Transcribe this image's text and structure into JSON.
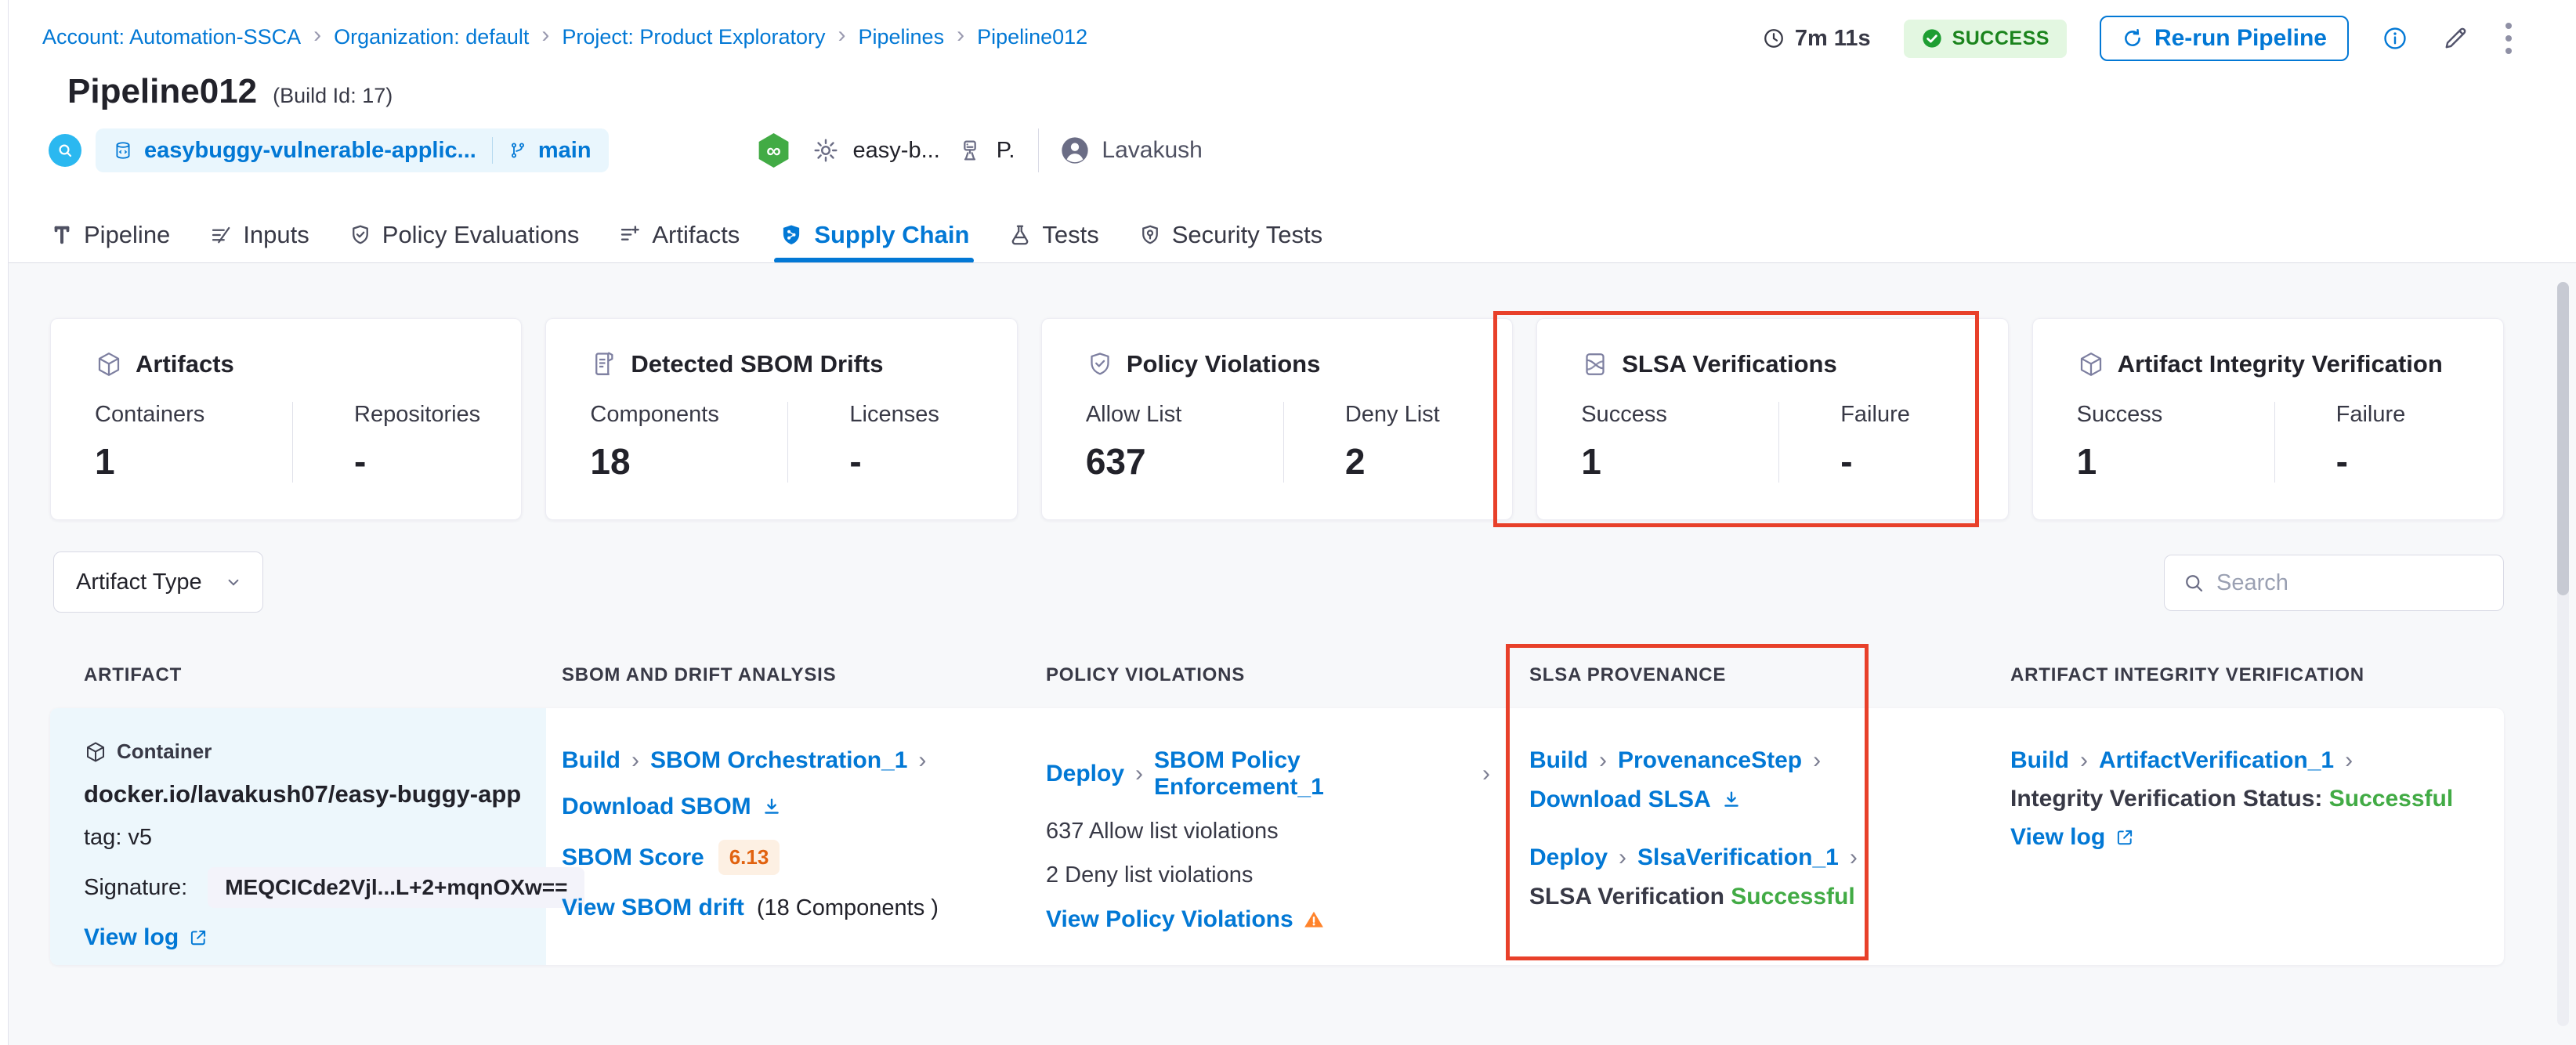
{
  "breadcrumb": {
    "items": [
      "Account: Automation-SSCA",
      "Organization: default",
      "Project: Product Exploratory",
      "Pipelines",
      "Pipeline012"
    ]
  },
  "header": {
    "duration": "7m 11s",
    "status": "SUCCESS",
    "rerun_label": "Re-run Pipeline",
    "title": "Pipeline012",
    "build_id": "(Build Id: 17)",
    "repo": "easybuggy-vulnerable-applic...",
    "branch": "main",
    "trigger_name": "easy-b...",
    "trigger_abbrev": "P.",
    "user": "Lavakush"
  },
  "tabs": [
    {
      "label": "Pipeline"
    },
    {
      "label": "Inputs"
    },
    {
      "label": "Policy Evaluations"
    },
    {
      "label": "Artifacts"
    },
    {
      "label": "Supply Chain",
      "active": true
    },
    {
      "label": "Tests"
    },
    {
      "label": "Security Tests"
    }
  ],
  "cards": [
    {
      "title": "Artifacts",
      "stats": [
        {
          "label": "Containers",
          "value": "1"
        },
        {
          "label": "Repositories",
          "value": "-"
        }
      ]
    },
    {
      "title": "Detected SBOM Drifts",
      "stats": [
        {
          "label": "Components",
          "value": "18"
        },
        {
          "label": "Licenses",
          "value": "-"
        }
      ]
    },
    {
      "title": "Policy Violations",
      "stats": [
        {
          "label": "Allow List",
          "value": "637"
        },
        {
          "label": "Deny List",
          "value": "2"
        }
      ]
    },
    {
      "title": "SLSA Verifications",
      "stats": [
        {
          "label": "Success",
          "value": "1"
        },
        {
          "label": "Failure",
          "value": "-"
        }
      ],
      "highlighted": true
    },
    {
      "title": "Artifact Integrity Verification",
      "stats": [
        {
          "label": "Success",
          "value": "1"
        },
        {
          "label": "Failure",
          "value": "-"
        }
      ]
    }
  ],
  "filters": {
    "artifact_type_label": "Artifact Type",
    "search_placeholder": "Search"
  },
  "table": {
    "columns": [
      "ARTIFACT",
      "SBOM AND DRIFT ANALYSIS",
      "POLICY VIOLATIONS",
      "SLSA PROVENANCE",
      "ARTIFACT INTEGRITY VERIFICATION"
    ],
    "row": {
      "artifact": {
        "type_label": "Container",
        "image": "docker.io/lavakush07/easy-buggy-app",
        "tag": "tag: v5",
        "signature_label": "Signature:",
        "signature": "MEQCICde2Vjl...L+2+mqnOXw==",
        "view_log": "View log"
      },
      "sbom": {
        "stage": "Build",
        "step": "SBOM Orchestration_1",
        "download_label": "Download SBOM",
        "score_label": "SBOM Score",
        "score": "6.13",
        "drift_link": "View SBOM drift",
        "drift_detail": "(18 Components )"
      },
      "policy": {
        "stage": "Deploy",
        "step": "SBOM Policy Enforcement_1",
        "allow": "637 Allow list violations",
        "deny": "2 Deny list violations",
        "view_link": "View Policy Violations"
      },
      "slsa": {
        "stage1": "Build",
        "step1": "ProvenanceStep",
        "download_label": "Download SLSA",
        "stage2": "Deploy",
        "step2": "SlsaVerification_1",
        "status_label": "SLSA Verification",
        "status_value": "Successful"
      },
      "integrity": {
        "stage": "Build",
        "step": "ArtifactVerification_1",
        "status_label": "Integrity Verification Status:",
        "status_value": "Successful",
        "view_log": "View log"
      }
    }
  },
  "colors": {
    "accent": "#0278d5",
    "success_text": "#1b841d",
    "success_bg": "#e3f7e1",
    "annotation_red": "#e8402a",
    "warning_orange": "#ff832b",
    "score_text": "#e1620f",
    "score_bg": "#fdf0e3",
    "ok_green": "#42ab45",
    "artifact_cell_bg": "#edf7fc"
  }
}
